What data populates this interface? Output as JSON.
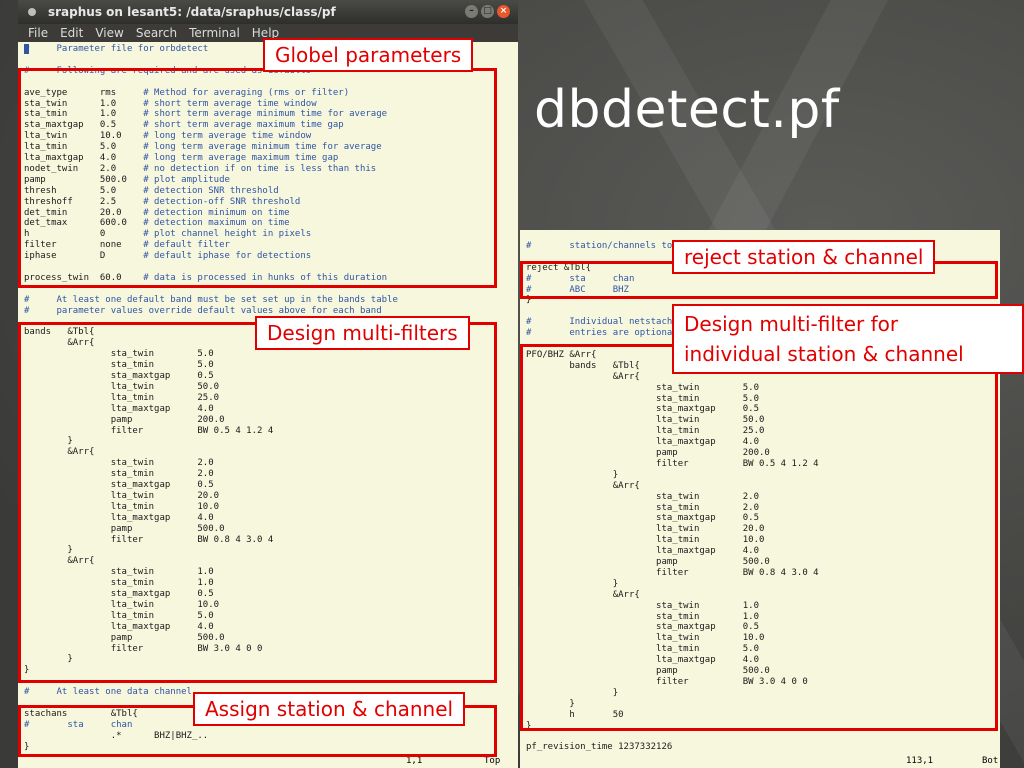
{
  "slide_title": "dbdetect.pf",
  "window": {
    "title": "sraphus on lesant5: /data/sraphus/class/pf",
    "menu": [
      "File",
      "Edit",
      "View",
      "Search",
      "Terminal",
      "Help"
    ],
    "status_pos": "1,1",
    "status_scroll": "Top"
  },
  "right_window": {
    "status_pos": "113,1",
    "status_scroll": "Bot"
  },
  "annotations": {
    "globel": "Globel parameters",
    "multi": "Design multi-filters",
    "assign": "Assign station & channel",
    "reject": "reject station & channel",
    "individual_1": "Design multi-filter for",
    "individual_2": "individual station & channel"
  },
  "left_lines": [
    {
      "k": "#",
      "c": "     Parameter file for orbdetect"
    },
    {
      "k": "",
      "c": ""
    },
    {
      "k": "#",
      "c": "     Following are required and are used as defaults"
    },
    {
      "k": "",
      "c": ""
    },
    {
      "k": "ave_type      rms     ",
      "c": "# Method for averaging (rms or filter)"
    },
    {
      "k": "sta_twin      1.0     ",
      "c": "# short term average time window"
    },
    {
      "k": "sta_tmin      1.0     ",
      "c": "# short term average minimum time for average"
    },
    {
      "k": "sta_maxtgap   0.5     ",
      "c": "# short term average maximum time gap"
    },
    {
      "k": "lta_twin      10.0    ",
      "c": "# long term average time window"
    },
    {
      "k": "lta_tmin      5.0     ",
      "c": "# long term average minimum time for average"
    },
    {
      "k": "lta_maxtgap   4.0     ",
      "c": "# long term average maximum time gap"
    },
    {
      "k": "nodet_twin    2.0     ",
      "c": "# no detection if on time is less than this"
    },
    {
      "k": "pamp          500.0   ",
      "c": "# plot amplitude"
    },
    {
      "k": "thresh        5.0     ",
      "c": "# detection SNR threshold"
    },
    {
      "k": "threshoff     2.5     ",
      "c": "# detection-off SNR threshold"
    },
    {
      "k": "det_tmin      20.0    ",
      "c": "# detection minimum on time"
    },
    {
      "k": "det_tmax      600.0   ",
      "c": "# detection maximum on time"
    },
    {
      "k": "h             0       ",
      "c": "# plot channel height in pixels"
    },
    {
      "k": "filter        none    ",
      "c": "# default filter"
    },
    {
      "k": "iphase        D       ",
      "c": "# default iphase for detections"
    },
    {
      "k": "",
      "c": ""
    },
    {
      "k": "process_twin  60.0    ",
      "c": "# data is processed in hunks of this duration"
    },
    {
      "k": "",
      "c": ""
    },
    {
      "k": "#",
      "c": "     At least one default band must be set set up in the bands table"
    },
    {
      "k": "#",
      "c": "     parameter values override default values above for each band"
    },
    {
      "k": "",
      "c": ""
    },
    {
      "k": "bands   &Tbl{",
      "c": ""
    },
    {
      "k": "        &Arr{",
      "c": ""
    },
    {
      "k": "                sta_twin        5.0",
      "c": ""
    },
    {
      "k": "                sta_tmin        5.0",
      "c": ""
    },
    {
      "k": "                sta_maxtgap     0.5",
      "c": ""
    },
    {
      "k": "                lta_twin        50.0",
      "c": ""
    },
    {
      "k": "                lta_tmin        25.0",
      "c": ""
    },
    {
      "k": "                lta_maxtgap     4.0",
      "c": ""
    },
    {
      "k": "                pamp            200.0",
      "c": ""
    },
    {
      "k": "                filter          BW 0.5 4 1.2 4",
      "c": ""
    },
    {
      "k": "        }",
      "c": ""
    },
    {
      "k": "        &Arr{",
      "c": ""
    },
    {
      "k": "                sta_twin        2.0",
      "c": ""
    },
    {
      "k": "                sta_tmin        2.0",
      "c": ""
    },
    {
      "k": "                sta_maxtgap     0.5",
      "c": ""
    },
    {
      "k": "                lta_twin        20.0",
      "c": ""
    },
    {
      "k": "                lta_tmin        10.0",
      "c": ""
    },
    {
      "k": "                lta_maxtgap     4.0",
      "c": ""
    },
    {
      "k": "                pamp            500.0",
      "c": ""
    },
    {
      "k": "                filter          BW 0.8 4 3.0 4",
      "c": ""
    },
    {
      "k": "        }",
      "c": ""
    },
    {
      "k": "        &Arr{",
      "c": ""
    },
    {
      "k": "                sta_twin        1.0",
      "c": ""
    },
    {
      "k": "                sta_tmin        1.0",
      "c": ""
    },
    {
      "k": "                sta_maxtgap     0.5",
      "c": ""
    },
    {
      "k": "                lta_twin        10.0",
      "c": ""
    },
    {
      "k": "                lta_tmin        5.0",
      "c": ""
    },
    {
      "k": "                lta_maxtgap     4.0",
      "c": ""
    },
    {
      "k": "                pamp            500.0",
      "c": ""
    },
    {
      "k": "                filter          BW 3.0 4 0 0",
      "c": ""
    },
    {
      "k": "        }",
      "c": ""
    },
    {
      "k": "}",
      "c": ""
    },
    {
      "k": "",
      "c": ""
    },
    {
      "k": "#",
      "c": "     At least one data channel"
    },
    {
      "k": "",
      "c": ""
    },
    {
      "k": "stachans        &Tbl{",
      "c": ""
    },
    {
      "k": "#",
      "c": "       sta     chan"
    },
    {
      "k": "                .*      BHZ|BHZ_..",
      "c": ""
    },
    {
      "k": "}",
      "c": ""
    }
  ],
  "right_lines": [
    {
      "k": "",
      "c": ""
    },
    {
      "k": "#",
      "c": "       station/channels to reject"
    },
    {
      "k": "",
      "c": ""
    },
    {
      "k": "reject &Tbl{",
      "c": ""
    },
    {
      "k": "#",
      "c": "       sta     chan"
    },
    {
      "k": "#",
      "c": "       ABC     BHZ"
    },
    {
      "k": "}",
      "c": ""
    },
    {
      "k": "",
      "c": ""
    },
    {
      "k": "#",
      "c": "       Individual netstachans"
    },
    {
      "k": "#",
      "c": "       entries are optional"
    },
    {
      "k": "",
      "c": ""
    },
    {
      "k": "PFO/BHZ &Arr{",
      "c": ""
    },
    {
      "k": "        bands   &Tbl{",
      "c": ""
    },
    {
      "k": "                &Arr{",
      "c": ""
    },
    {
      "k": "                        sta_twin        5.0",
      "c": ""
    },
    {
      "k": "                        sta_tmin        5.0",
      "c": ""
    },
    {
      "k": "                        sta_maxtgap     0.5",
      "c": ""
    },
    {
      "k": "                        lta_twin        50.0",
      "c": ""
    },
    {
      "k": "                        lta_tmin        25.0",
      "c": ""
    },
    {
      "k": "                        lta_maxtgap     4.0",
      "c": ""
    },
    {
      "k": "                        pamp            200.0",
      "c": ""
    },
    {
      "k": "                        filter          BW 0.5 4 1.2 4",
      "c": ""
    },
    {
      "k": "                }",
      "c": ""
    },
    {
      "k": "                &Arr{",
      "c": ""
    },
    {
      "k": "                        sta_twin        2.0",
      "c": ""
    },
    {
      "k": "                        sta_tmin        2.0",
      "c": ""
    },
    {
      "k": "                        sta_maxtgap     0.5",
      "c": ""
    },
    {
      "k": "                        lta_twin        20.0",
      "c": ""
    },
    {
      "k": "                        lta_tmin        10.0",
      "c": ""
    },
    {
      "k": "                        lta_maxtgap     4.0",
      "c": ""
    },
    {
      "k": "                        pamp            500.0",
      "c": ""
    },
    {
      "k": "                        filter          BW 0.8 4 3.0 4",
      "c": ""
    },
    {
      "k": "                }",
      "c": ""
    },
    {
      "k": "                &Arr{",
      "c": ""
    },
    {
      "k": "                        sta_twin        1.0",
      "c": ""
    },
    {
      "k": "                        sta_tmin        1.0",
      "c": ""
    },
    {
      "k": "                        sta_maxtgap     0.5",
      "c": ""
    },
    {
      "k": "                        lta_twin        10.0",
      "c": ""
    },
    {
      "k": "                        lta_tmin        5.0",
      "c": ""
    },
    {
      "k": "                        lta_maxtgap     4.0",
      "c": ""
    },
    {
      "k": "                        pamp            500.0",
      "c": ""
    },
    {
      "k": "                        filter          BW 3.0 4 0 0",
      "c": ""
    },
    {
      "k": "                }",
      "c": ""
    },
    {
      "k": "        }",
      "c": ""
    },
    {
      "k": "        h       50",
      "c": ""
    },
    {
      "k": "}",
      "c": ""
    },
    {
      "k": "",
      "c": ""
    },
    {
      "k": "pf_revision_time 1237332126",
      "c": ""
    }
  ]
}
